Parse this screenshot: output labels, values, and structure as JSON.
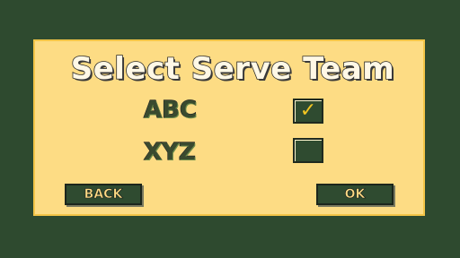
{
  "dialog": {
    "title": "Select Serve Team",
    "teams": [
      {
        "label": "ABC",
        "checked": true
      },
      {
        "label": "XYZ",
        "checked": false
      }
    ],
    "check_glyph": "✓",
    "buttons": {
      "back_label": "BACK",
      "ok_label": "OK"
    }
  },
  "colors": {
    "background": "#2e4a2f",
    "panel": "#fddc84",
    "checkmark": "#f2c522",
    "button": "#2f4b30",
    "button_text": "#fddc84"
  }
}
